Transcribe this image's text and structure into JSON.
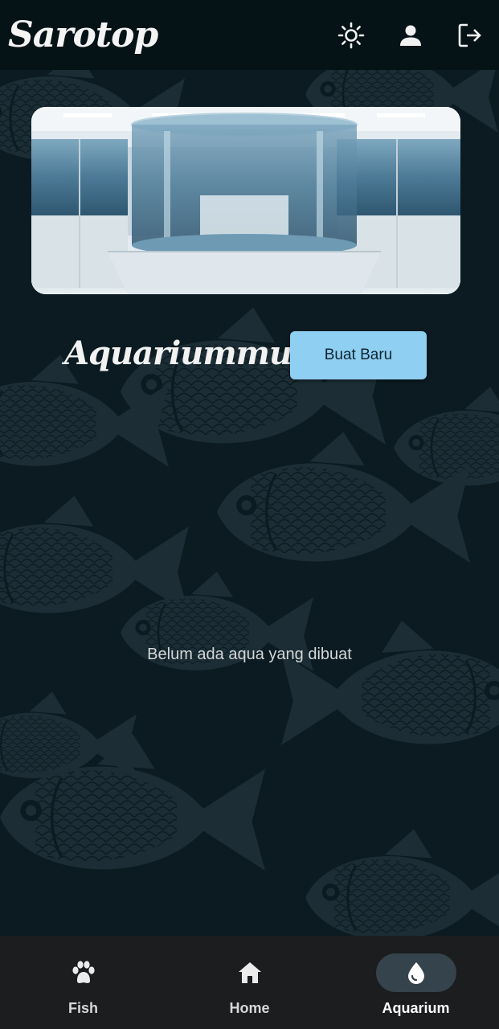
{
  "app_bar": {
    "brand": "Sarotop",
    "actions": [
      {
        "icon": "sun-icon",
        "name": "theme-toggle-button"
      },
      {
        "icon": "person-icon",
        "name": "profile-button"
      },
      {
        "icon": "logout-icon",
        "name": "logout-button"
      }
    ]
  },
  "main": {
    "section_title": "Aquariummu",
    "new_button_label": "Buat Baru",
    "empty_message": "Belum ada aqua yang dibuat"
  },
  "bottom_nav": {
    "items": [
      {
        "label": "Fish",
        "icon": "paw-icon",
        "active": false
      },
      {
        "label": "Home",
        "icon": "home-icon",
        "active": false
      },
      {
        "label": "Aquarium",
        "icon": "water-drop-icon",
        "active": true
      }
    ]
  },
  "colors": {
    "app_bar": "#061316",
    "background": "#0b1b21",
    "button": "#8fcff2",
    "nav_bar": "#1b1d1e",
    "nav_active_pill": "#35434d"
  }
}
